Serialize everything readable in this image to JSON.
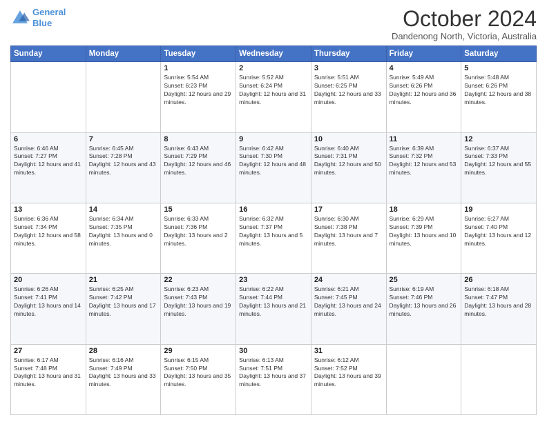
{
  "header": {
    "logo_line1": "General",
    "logo_line2": "Blue",
    "month_year": "October 2024",
    "location": "Dandenong North, Victoria, Australia"
  },
  "days_of_week": [
    "Sunday",
    "Monday",
    "Tuesday",
    "Wednesday",
    "Thursday",
    "Friday",
    "Saturday"
  ],
  "weeks": [
    [
      {
        "day": "",
        "info": ""
      },
      {
        "day": "",
        "info": ""
      },
      {
        "day": "1",
        "info": "Sunrise: 5:54 AM\nSunset: 6:23 PM\nDaylight: 12 hours and 29 minutes."
      },
      {
        "day": "2",
        "info": "Sunrise: 5:52 AM\nSunset: 6:24 PM\nDaylight: 12 hours and 31 minutes."
      },
      {
        "day": "3",
        "info": "Sunrise: 5:51 AM\nSunset: 6:25 PM\nDaylight: 12 hours and 33 minutes."
      },
      {
        "day": "4",
        "info": "Sunrise: 5:49 AM\nSunset: 6:26 PM\nDaylight: 12 hours and 36 minutes."
      },
      {
        "day": "5",
        "info": "Sunrise: 5:48 AM\nSunset: 6:26 PM\nDaylight: 12 hours and 38 minutes."
      }
    ],
    [
      {
        "day": "6",
        "info": "Sunrise: 6:46 AM\nSunset: 7:27 PM\nDaylight: 12 hours and 41 minutes."
      },
      {
        "day": "7",
        "info": "Sunrise: 6:45 AM\nSunset: 7:28 PM\nDaylight: 12 hours and 43 minutes."
      },
      {
        "day": "8",
        "info": "Sunrise: 6:43 AM\nSunset: 7:29 PM\nDaylight: 12 hours and 46 minutes."
      },
      {
        "day": "9",
        "info": "Sunrise: 6:42 AM\nSunset: 7:30 PM\nDaylight: 12 hours and 48 minutes."
      },
      {
        "day": "10",
        "info": "Sunrise: 6:40 AM\nSunset: 7:31 PM\nDaylight: 12 hours and 50 minutes."
      },
      {
        "day": "11",
        "info": "Sunrise: 6:39 AM\nSunset: 7:32 PM\nDaylight: 12 hours and 53 minutes."
      },
      {
        "day": "12",
        "info": "Sunrise: 6:37 AM\nSunset: 7:33 PM\nDaylight: 12 hours and 55 minutes."
      }
    ],
    [
      {
        "day": "13",
        "info": "Sunrise: 6:36 AM\nSunset: 7:34 PM\nDaylight: 12 hours and 58 minutes."
      },
      {
        "day": "14",
        "info": "Sunrise: 6:34 AM\nSunset: 7:35 PM\nDaylight: 13 hours and 0 minutes."
      },
      {
        "day": "15",
        "info": "Sunrise: 6:33 AM\nSunset: 7:36 PM\nDaylight: 13 hours and 2 minutes."
      },
      {
        "day": "16",
        "info": "Sunrise: 6:32 AM\nSunset: 7:37 PM\nDaylight: 13 hours and 5 minutes."
      },
      {
        "day": "17",
        "info": "Sunrise: 6:30 AM\nSunset: 7:38 PM\nDaylight: 13 hours and 7 minutes."
      },
      {
        "day": "18",
        "info": "Sunrise: 6:29 AM\nSunset: 7:39 PM\nDaylight: 13 hours and 10 minutes."
      },
      {
        "day": "19",
        "info": "Sunrise: 6:27 AM\nSunset: 7:40 PM\nDaylight: 13 hours and 12 minutes."
      }
    ],
    [
      {
        "day": "20",
        "info": "Sunrise: 6:26 AM\nSunset: 7:41 PM\nDaylight: 13 hours and 14 minutes."
      },
      {
        "day": "21",
        "info": "Sunrise: 6:25 AM\nSunset: 7:42 PM\nDaylight: 13 hours and 17 minutes."
      },
      {
        "day": "22",
        "info": "Sunrise: 6:23 AM\nSunset: 7:43 PM\nDaylight: 13 hours and 19 minutes."
      },
      {
        "day": "23",
        "info": "Sunrise: 6:22 AM\nSunset: 7:44 PM\nDaylight: 13 hours and 21 minutes."
      },
      {
        "day": "24",
        "info": "Sunrise: 6:21 AM\nSunset: 7:45 PM\nDaylight: 13 hours and 24 minutes."
      },
      {
        "day": "25",
        "info": "Sunrise: 6:19 AM\nSunset: 7:46 PM\nDaylight: 13 hours and 26 minutes."
      },
      {
        "day": "26",
        "info": "Sunrise: 6:18 AM\nSunset: 7:47 PM\nDaylight: 13 hours and 28 minutes."
      }
    ],
    [
      {
        "day": "27",
        "info": "Sunrise: 6:17 AM\nSunset: 7:48 PM\nDaylight: 13 hours and 31 minutes."
      },
      {
        "day": "28",
        "info": "Sunrise: 6:16 AM\nSunset: 7:49 PM\nDaylight: 13 hours and 33 minutes."
      },
      {
        "day": "29",
        "info": "Sunrise: 6:15 AM\nSunset: 7:50 PM\nDaylight: 13 hours and 35 minutes."
      },
      {
        "day": "30",
        "info": "Sunrise: 6:13 AM\nSunset: 7:51 PM\nDaylight: 13 hours and 37 minutes."
      },
      {
        "day": "31",
        "info": "Sunrise: 6:12 AM\nSunset: 7:52 PM\nDaylight: 13 hours and 39 minutes."
      },
      {
        "day": "",
        "info": ""
      },
      {
        "day": "",
        "info": ""
      }
    ]
  ]
}
